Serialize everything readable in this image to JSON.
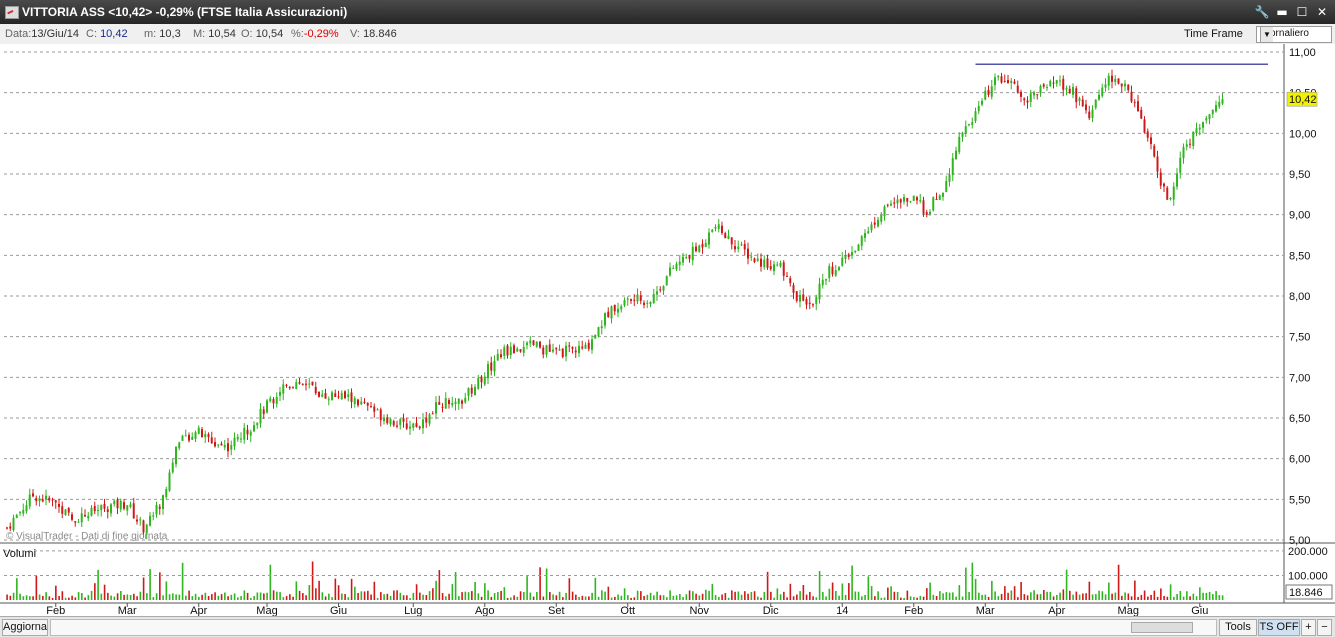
{
  "window": {
    "title": "VITTORIA ASS <10,42> -0,29%  (FTSE Italia Assicurazioni)"
  },
  "info": {
    "data_label": "Data:",
    "data_value": "13/Giu/14",
    "c_label": "C:",
    "c_value": "10,42",
    "m_label": "m:",
    "m_value": "10,3",
    "M_label": "M:",
    "M_value": "10,54",
    "o_label": "O:",
    "o_value": "10,54",
    "pct_label": "%:",
    "pct_value": "-0,29%",
    "v_label": "V:",
    "v_value": "18.846",
    "timeframe_label": "Time Frame",
    "timeframe_value": "Giornaliero"
  },
  "bottom": {
    "aggiorna": "Aggiorna",
    "tools": "Tools",
    "ts": "TS OFF",
    "plus": "+",
    "minus": "−"
  },
  "colors": {
    "up": "#2fb51f",
    "down": "#d01818",
    "price_tag": "#f1f100",
    "resistance": "#1a1a8a",
    "grid": "#9a9a9a"
  },
  "chart_data": {
    "type": "candlestick",
    "y_axis": {
      "min": 5.0,
      "max": 11.0,
      "ticks": [
        "5,00",
        "5,50",
        "6,00",
        "6,50",
        "7,00",
        "7,50",
        "8,00",
        "8,50",
        "9,00",
        "9,50",
        "10,00",
        "10,50",
        "11,00"
      ],
      "tick_values": [
        5.0,
        5.5,
        6.0,
        6.5,
        7.0,
        7.5,
        8.0,
        8.5,
        9.0,
        9.5,
        10.0,
        10.5,
        11.0
      ]
    },
    "x_axis": {
      "months": [
        "Feb",
        "Mar",
        "Apr",
        "Mag",
        "Giu",
        "Lug",
        "Ago",
        "Set",
        "Ott",
        "Nov",
        "Dic",
        "14",
        "Feb",
        "Mar",
        "Apr",
        "Mag",
        "Giu"
      ],
      "month_start_index": [
        15,
        37,
        59,
        80,
        102,
        125,
        147,
        169,
        191,
        213,
        235,
        257,
        279,
        301,
        323,
        345,
        367
      ]
    },
    "n_bars": 375,
    "price_anchors": [
      [
        0,
        5.15
      ],
      [
        8,
        5.55
      ],
      [
        15,
        5.45
      ],
      [
        20,
        5.25
      ],
      [
        30,
        5.4
      ],
      [
        37,
        5.45
      ],
      [
        40,
        5.25
      ],
      [
        42,
        5.15
      ],
      [
        48,
        5.5
      ],
      [
        52,
        6.15
      ],
      [
        58,
        6.35
      ],
      [
        63,
        6.2
      ],
      [
        68,
        6.15
      ],
      [
        74,
        6.35
      ],
      [
        85,
        6.9
      ],
      [
        92,
        6.95
      ],
      [
        96,
        6.8
      ],
      [
        105,
        6.75
      ],
      [
        112,
        6.6
      ],
      [
        122,
        6.4
      ],
      [
        128,
        6.45
      ],
      [
        133,
        6.7
      ],
      [
        138,
        6.65
      ],
      [
        143,
        6.85
      ],
      [
        152,
        7.3
      ],
      [
        162,
        7.4
      ],
      [
        168,
        7.3
      ],
      [
        178,
        7.35
      ],
      [
        185,
        7.8
      ],
      [
        191,
        7.95
      ],
      [
        198,
        7.95
      ],
      [
        205,
        8.35
      ],
      [
        213,
        8.6
      ],
      [
        218,
        8.85
      ],
      [
        222,
        8.7
      ],
      [
        230,
        8.45
      ],
      [
        238,
        8.35
      ],
      [
        243,
        7.95
      ],
      [
        248,
        7.95
      ],
      [
        253,
        8.3
      ],
      [
        261,
        8.6
      ],
      [
        270,
        9.1
      ],
      [
        278,
        9.2
      ],
      [
        283,
        9.05
      ],
      [
        288,
        9.3
      ],
      [
        293,
        9.95
      ],
      [
        298,
        10.25
      ],
      [
        303,
        10.6
      ],
      [
        307,
        10.7
      ],
      [
        310,
        10.55
      ],
      [
        313,
        10.4
      ],
      [
        318,
        10.55
      ],
      [
        323,
        10.6
      ],
      [
        328,
        10.5
      ],
      [
        333,
        10.25
      ],
      [
        338,
        10.65
      ],
      [
        343,
        10.6
      ],
      [
        347,
        10.4
      ],
      [
        351,
        9.95
      ],
      [
        355,
        9.4
      ],
      [
        358,
        9.15
      ],
      [
        361,
        9.7
      ],
      [
        365,
        10.0
      ],
      [
        370,
        10.2
      ],
      [
        375,
        10.42
      ]
    ],
    "last_close": 10.42,
    "last_price_label": "10,42",
    "resistance": {
      "value": 10.85,
      "from_index": 298,
      "to_index": 388
    },
    "volume": {
      "label": "Volumi",
      "ticks": [
        "100.000",
        "200.000"
      ],
      "tick_values": [
        100000,
        200000
      ],
      "max": 220000,
      "last": "18.846"
    },
    "watermark": "© VisualTrader - Dati di fine giornata"
  }
}
